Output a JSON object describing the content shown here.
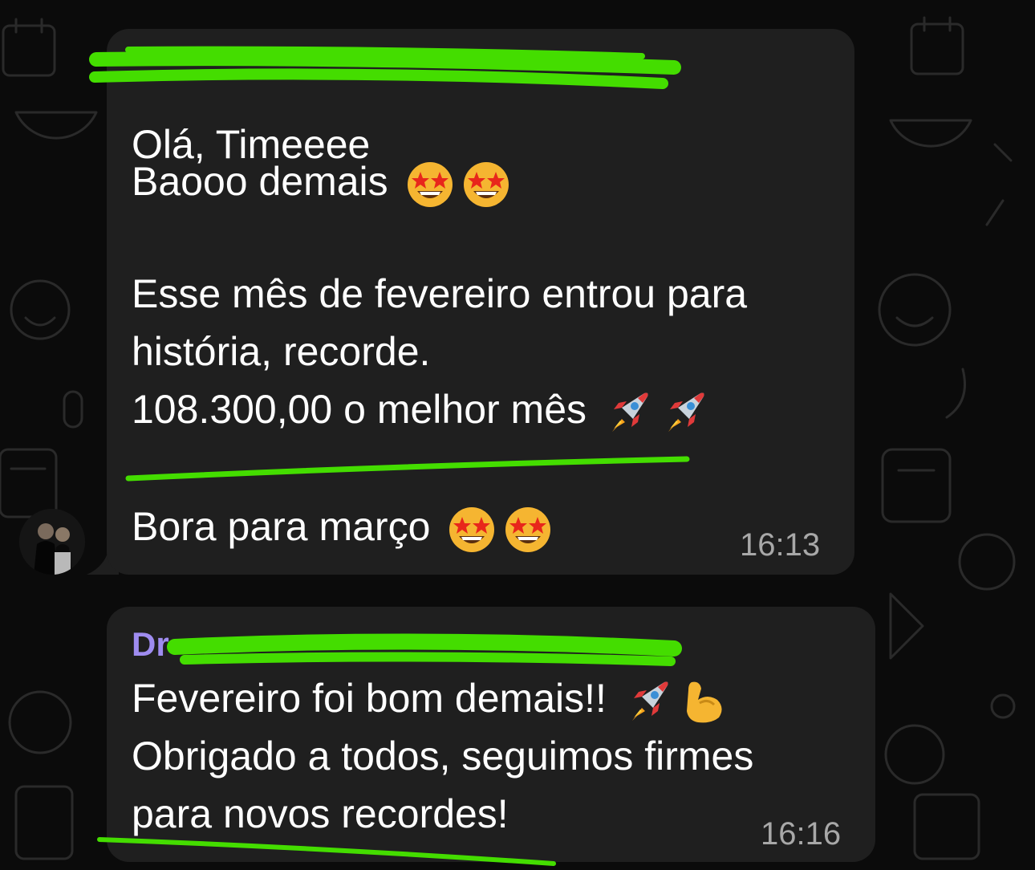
{
  "messages": [
    {
      "sender_redacted": true,
      "lines": [
        "Olá, Timeeee",
        "Baooo demais",
        "",
        "Esse mês de fevereiro entrou para",
        "história, recorde.",
        "108.300,00 o melhor mês",
        "",
        "Bora para março"
      ],
      "time": "16:13"
    },
    {
      "sender_visible": "Dr",
      "lines": [
        "Fevereiro foi bom demais!!",
        "Obrigado a todos, seguimos firmes",
        "para novos recordes!"
      ],
      "time": "16:16"
    }
  ],
  "icons": {
    "star_struck": "star-struck-emoji",
    "rocket": "rocket-emoji",
    "flexed_biceps": "flexed-biceps-emoji"
  },
  "colors": {
    "bubble": "#1f1f1f",
    "background": "#0b0b0b",
    "sender_name": "#9f8cf0",
    "highlight_marker": "#44dd00",
    "timestamp": "#a8a8a8"
  }
}
